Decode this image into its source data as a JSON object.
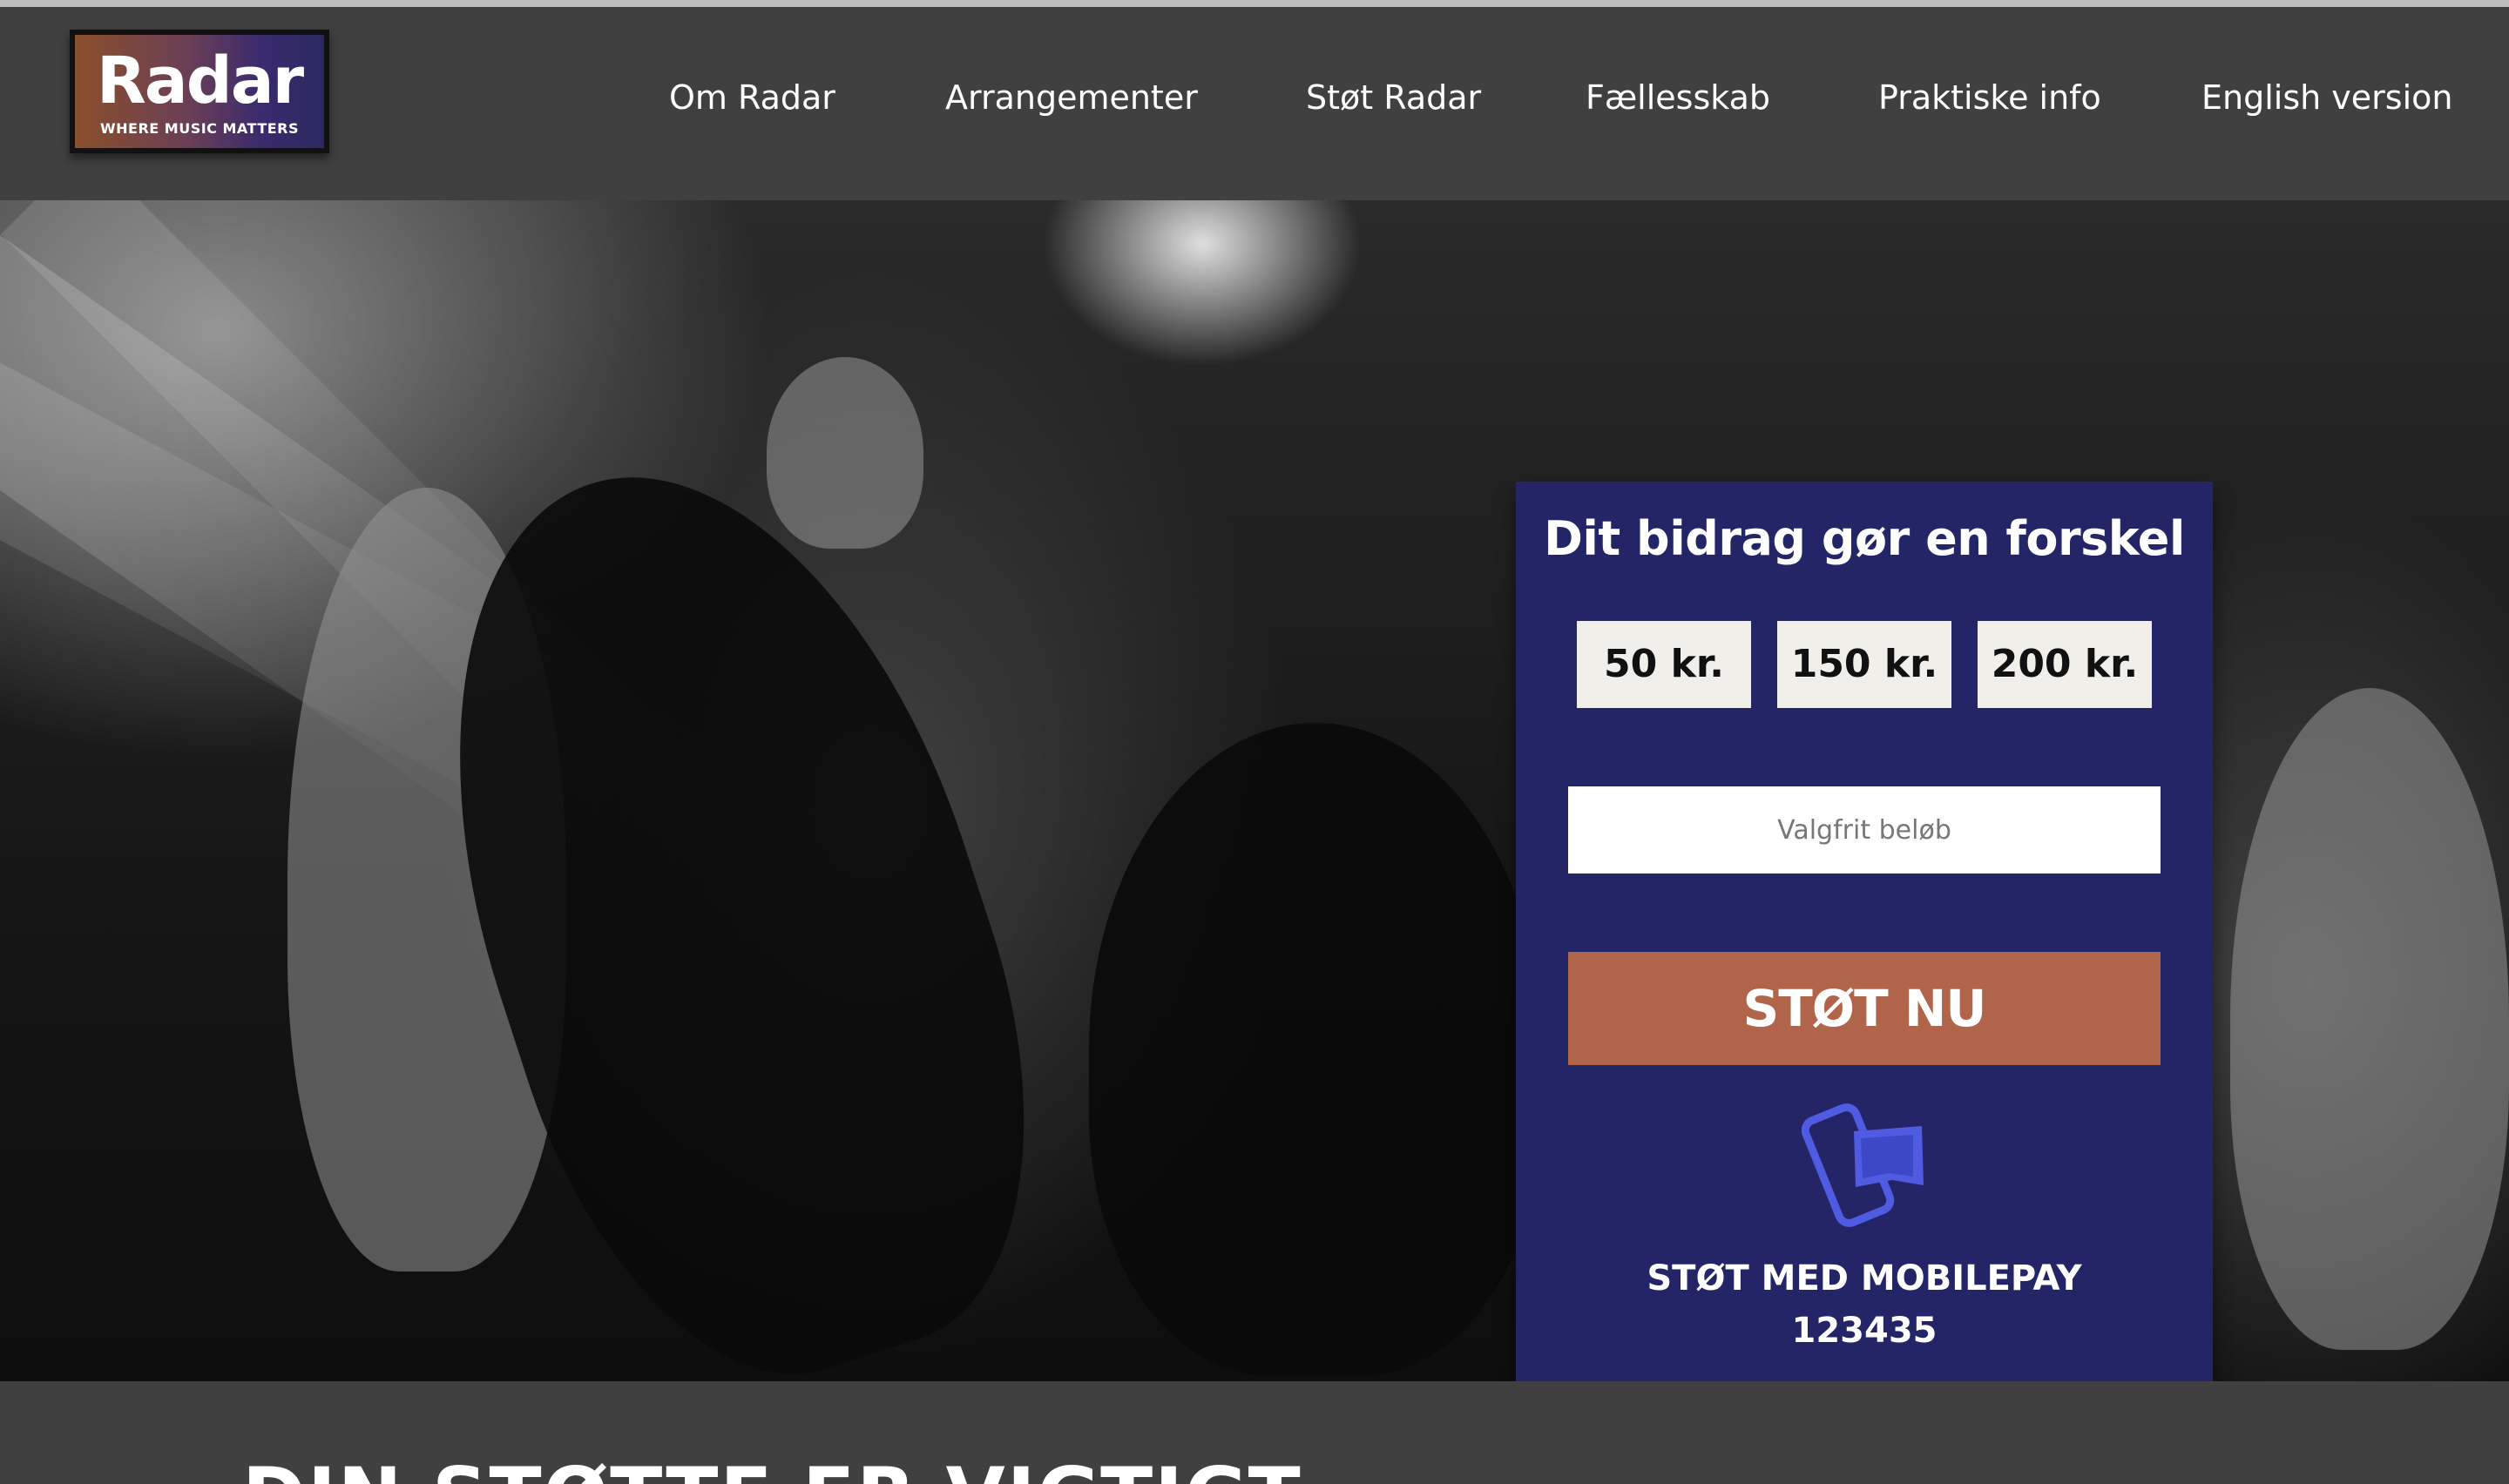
{
  "logo": {
    "wordmark": "Radar",
    "tagline": "WHERE MUSIC MATTERS"
  },
  "nav": {
    "items": [
      {
        "label": "Om Radar"
      },
      {
        "label": "Arrangementer"
      },
      {
        "label": "Støt Radar"
      },
      {
        "label": "Fællesskab"
      },
      {
        "label": "Praktiske info"
      },
      {
        "label": "English version"
      }
    ]
  },
  "donate": {
    "title": "Dit bidrag gør en forskel",
    "amounts": [
      "50 kr.",
      "150 kr.",
      "200 kr."
    ],
    "custom_placeholder": "Valgfrit beløb",
    "cta_label": "STØT NU",
    "mobilepay_label": "STØT MED MOBILEPAY",
    "mobilepay_number": "123435",
    "colors": {
      "panel": "#232566",
      "cta": "#b0654a",
      "amount_bg": "#f1efe9",
      "icon": "#4f5be0"
    }
  },
  "section": {
    "heading": "DIN STØTTE ER VIGTIGT"
  },
  "icons": {
    "mobilepay": "mobilepay-icon"
  }
}
